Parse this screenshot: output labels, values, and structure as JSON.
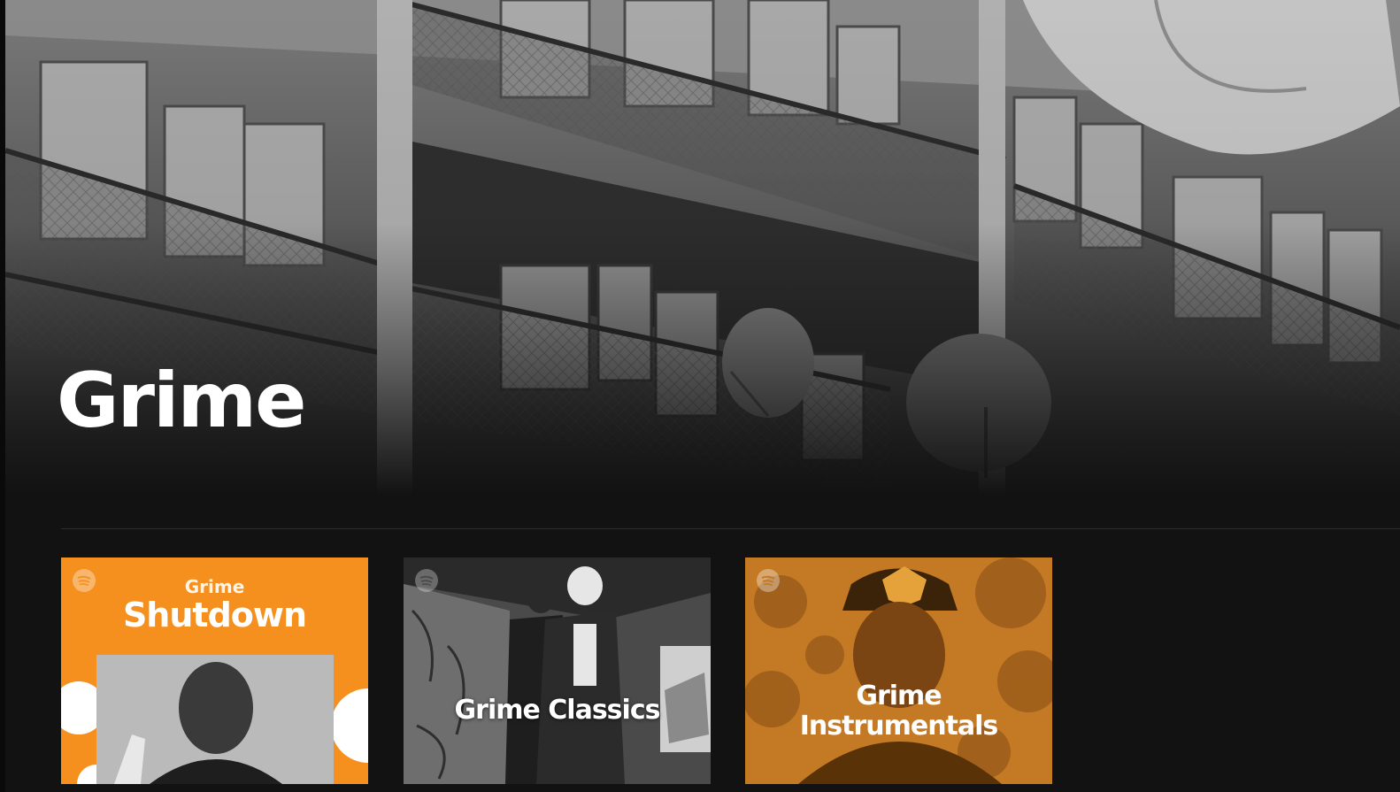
{
  "genre": {
    "title": "Grime"
  },
  "playlists": [
    {
      "brand_icon": "spotify-icon",
      "small_label": "Grime",
      "big_label": "Shutdown",
      "accent_color": "#f5901e"
    },
    {
      "brand_icon": "spotify-icon",
      "title": "Grime Classics",
      "accent_color": "#5a5a5a"
    },
    {
      "brand_icon": "spotify-icon",
      "title_line1": "Grime",
      "title_line2": "Instrumentals",
      "accent_color": "#c47a24"
    }
  ]
}
